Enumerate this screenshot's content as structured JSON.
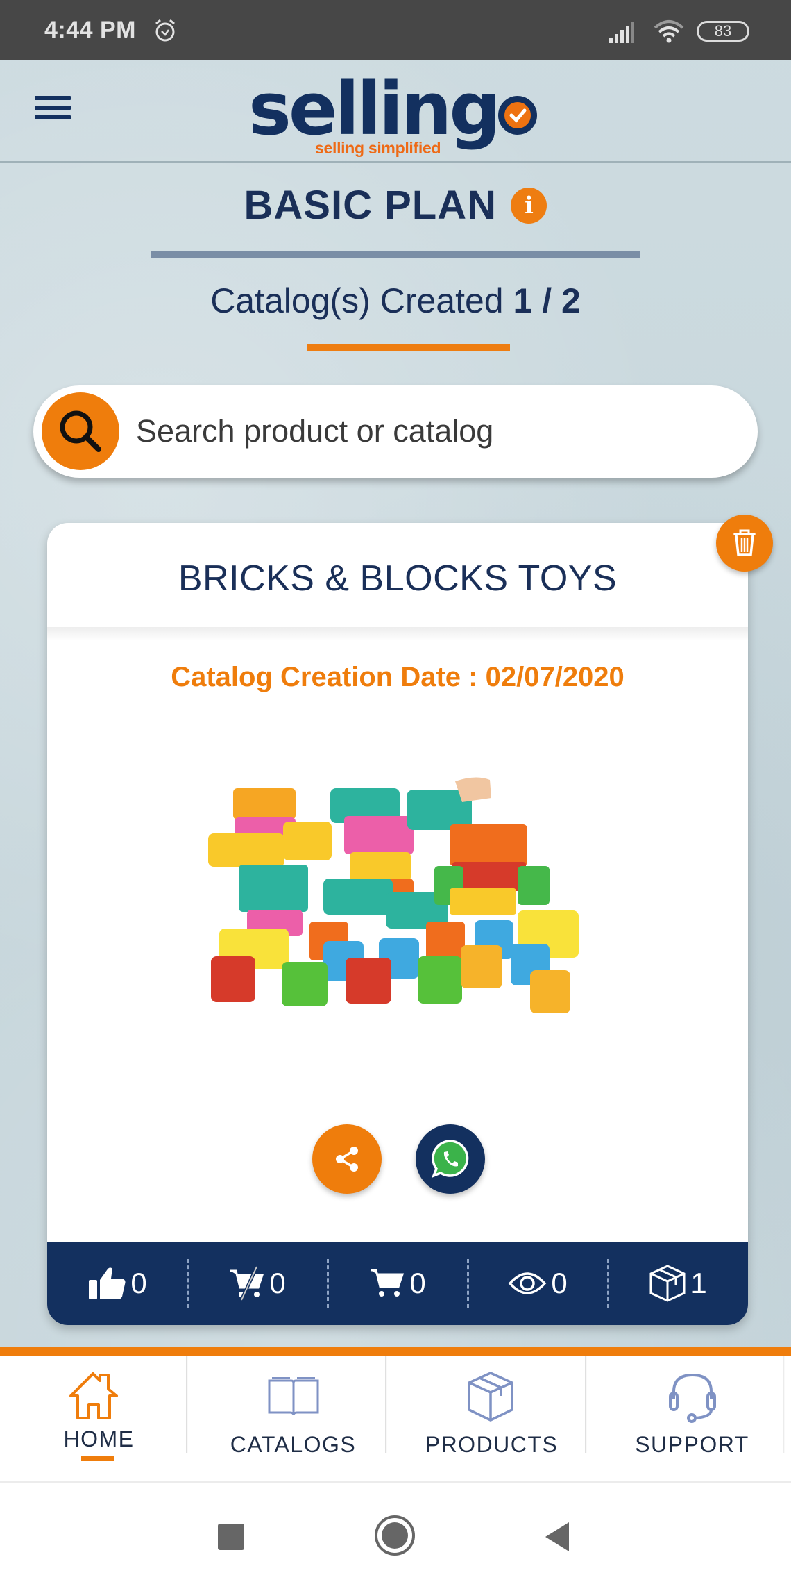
{
  "status_bar": {
    "time": "4:44 PM",
    "battery": "83",
    "icons": [
      "alarm-icon",
      "signal-icon",
      "wifi-icon",
      "battery-icon"
    ]
  },
  "header": {
    "logo_text": "sellingo",
    "logo_text_main": "selling",
    "tagline": "selling simplified",
    "menu_icon": "hamburger-menu-icon"
  },
  "plan": {
    "title": "BASIC PLAN",
    "info_icon": "i",
    "catalog_label": "Catalog(s) Created",
    "catalog_count": "1 / 2",
    "catalogs_used": 1,
    "catalogs_limit": 2
  },
  "search": {
    "placeholder": "Search product or catalog",
    "value": ""
  },
  "catalog_card": {
    "title": "BRICKS & BLOCKS TOYS",
    "creation_date_label": "Catalog Creation Date : 02/07/2020",
    "creation_date": "02/07/2020",
    "image_alt": "Colorful toy building blocks",
    "actions": {
      "share_icon": "share-icon",
      "whatsapp_icon": "whatsapp-icon",
      "delete_icon": "trash-icon"
    },
    "stats": [
      {
        "name": "likes",
        "icon": "thumbs-up-icon",
        "value": "0"
      },
      {
        "name": "cart-removed",
        "icon": "cart-remove-icon",
        "value": "0"
      },
      {
        "name": "cart-added",
        "icon": "cart-icon",
        "value": "0"
      },
      {
        "name": "views",
        "icon": "eye-icon",
        "value": "0"
      },
      {
        "name": "products",
        "icon": "box-icon",
        "value": "1"
      }
    ]
  },
  "bottom_nav": {
    "active": "HOME",
    "items": [
      {
        "label": "HOME",
        "icon": "home-icon"
      },
      {
        "label": "CATALOGS",
        "icon": "book-icon"
      },
      {
        "label": "PRODUCTS",
        "icon": "box-icon"
      },
      {
        "label": "SUPPORT",
        "icon": "headset-icon"
      }
    ]
  },
  "colors": {
    "brand_navy": "#13305f",
    "brand_orange": "#ef7d0c",
    "background": "#c9d8dd",
    "nav_icon_inactive": "#7f92c4"
  }
}
